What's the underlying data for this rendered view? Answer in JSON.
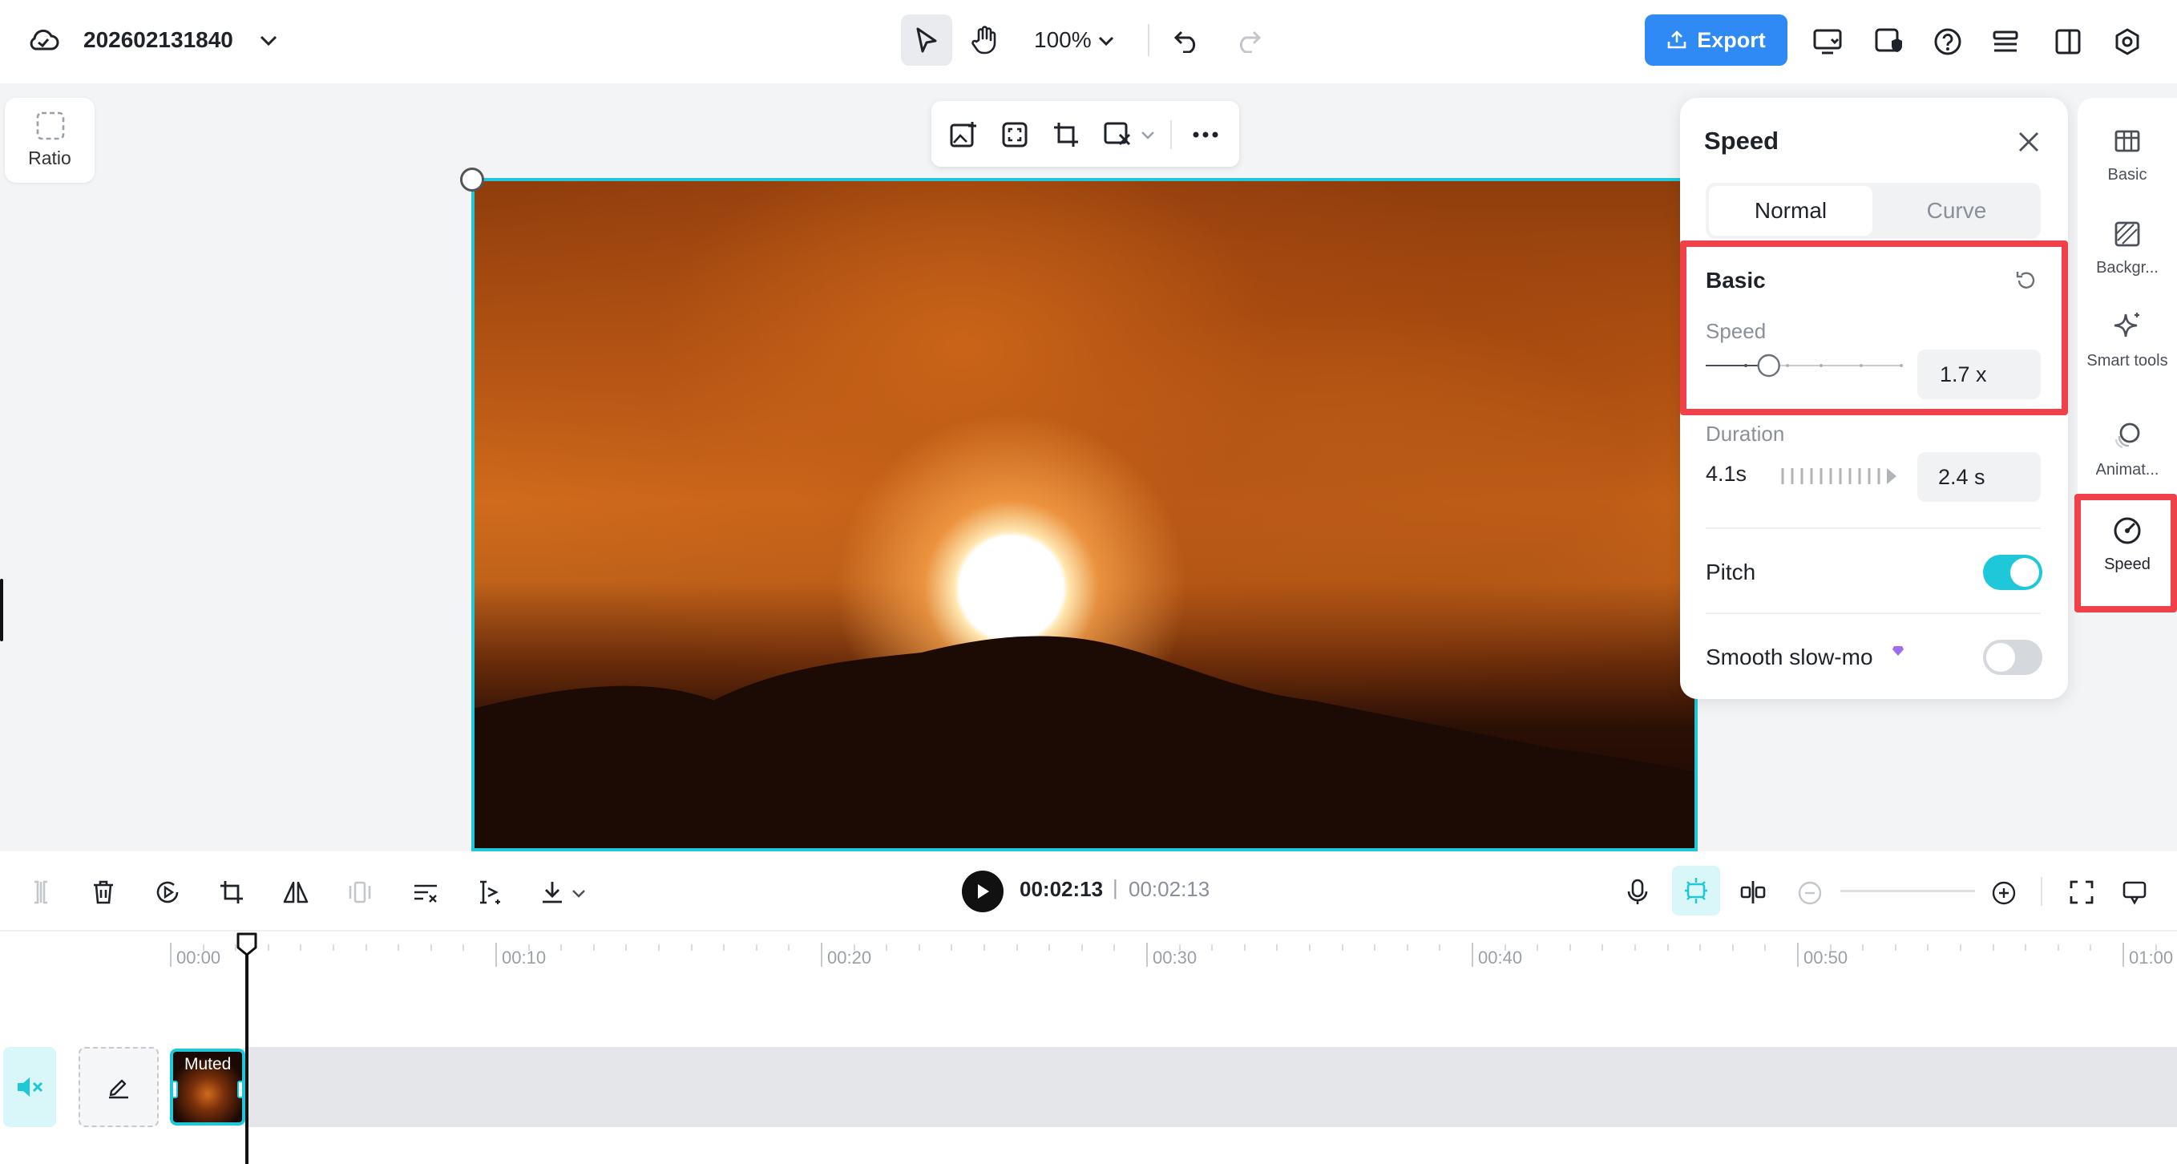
{
  "topbar": {
    "project_title": "202602131840",
    "zoom": "100%",
    "export_label": "Export"
  },
  "canvas": {
    "ratio_label": "Ratio"
  },
  "speed_panel": {
    "title": "Speed",
    "tabs": [
      {
        "label": "Normal",
        "active": true
      },
      {
        "label": "Curve",
        "active": false
      }
    ],
    "basic": {
      "title": "Basic",
      "speed_label": "Speed",
      "speed_value": "1.7 x",
      "speed_slider_fraction": 0.32
    },
    "duration": {
      "label": "Duration",
      "original": "4.1s",
      "value": "2.4 s"
    },
    "pitch": {
      "label": "Pitch",
      "on": true
    },
    "smooth_slowmo": {
      "label": "Smooth slow-mo",
      "on": false
    }
  },
  "right_sidebar": {
    "items": [
      {
        "label": "Basic",
        "icon": "basic-icon"
      },
      {
        "label": "Backgr...",
        "icon": "background-icon"
      },
      {
        "label": "Smart tools",
        "icon": "sparkle-icon"
      },
      {
        "label": "Animat...",
        "icon": "animation-icon"
      },
      {
        "label": "Speed",
        "icon": "speed-icon",
        "active": true
      }
    ]
  },
  "playback": {
    "current_time": "00:02:13",
    "separator": "|",
    "total_time": "00:02:13"
  },
  "ruler": {
    "labels": [
      "00:00",
      "00:10",
      "00:20",
      "00:30",
      "00:40",
      "00:50",
      "01:00"
    ]
  },
  "track": {
    "clip_label": "Muted"
  },
  "colors": {
    "accent": "#1fc8d9",
    "export": "#2f8af5",
    "highlight": "#f0404a"
  }
}
